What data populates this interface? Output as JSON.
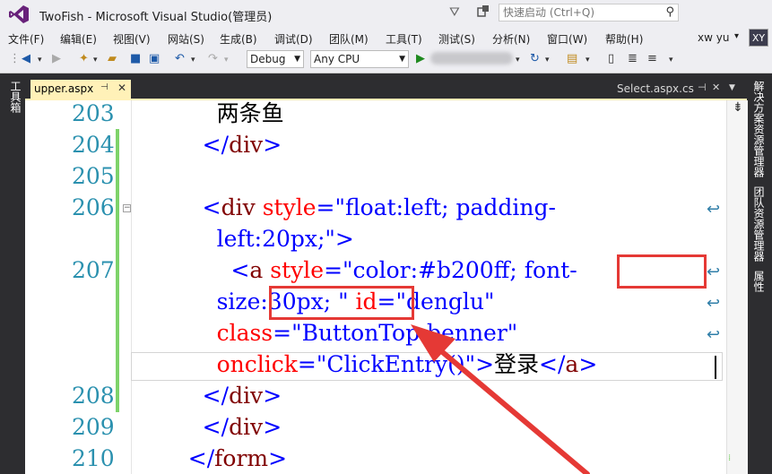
{
  "window": {
    "title": "TwoFish - Microsoft Visual Studio(管理员)",
    "quick_launch_placeholder": "快速启动 (Ctrl+Q)"
  },
  "menu": {
    "items": [
      "文件(F)",
      "编辑(E)",
      "视图(V)",
      "网站(S)",
      "生成(B)",
      "调试(D)",
      "团队(M)",
      "工具(T)",
      "测试(S)",
      "分析(N)",
      "窗口(W)",
      "帮助(H)"
    ],
    "user_name": "xw yu",
    "avatar_initials": "XY"
  },
  "toolbar": {
    "configuration": "Debug",
    "platform": "Any CPU"
  },
  "side_panels": {
    "left": "工具箱",
    "right": [
      "解决方案资源管理器",
      "团队资源管理器",
      "属性"
    ]
  },
  "tabs": {
    "active": "upper.aspx",
    "inactive": "Select.aspx.cs"
  },
  "editor": {
    "line_numbers": [
      "203",
      "204",
      "205",
      "206",
      "207",
      "208",
      "209",
      "210"
    ],
    "lines": {
      "l203": [
        {
          "t": "        两条鱼",
          "c": "black"
        }
      ],
      "l204": [
        {
          "t": "      </",
          "c": "blue"
        },
        {
          "t": "div",
          "c": "maroon"
        },
        {
          "t": ">",
          "c": "blue"
        }
      ],
      "l206a": [
        {
          "t": "      <",
          "c": "blue"
        },
        {
          "t": "div",
          "c": "maroon"
        },
        {
          "t": " style",
          "c": "red"
        },
        {
          "t": "=\"float:left; padding-",
          "c": "blue"
        }
      ],
      "l206b": [
        {
          "t": "        left:20px;\">",
          "c": "blue"
        }
      ],
      "l207a": [
        {
          "t": "          <",
          "c": "blue"
        },
        {
          "t": "a",
          "c": "maroon"
        },
        {
          "t": " style",
          "c": "red"
        },
        {
          "t": "=\"color:#b200ff; font-",
          "c": "blue"
        }
      ],
      "l207b": [
        {
          "t": "        size:30px; \"",
          "c": "blue"
        },
        {
          "t": " id",
          "c": "red"
        },
        {
          "t": "=\"denglu\"",
          "c": "blue"
        }
      ],
      "l207c": [
        {
          "t": "        class",
          "c": "red"
        },
        {
          "t": "=\"ButtonTop benner\"",
          "c": "blue"
        }
      ],
      "l207d": [
        {
          "t": "        onclick",
          "c": "red"
        },
        {
          "t": "=\"ClickEntry()\">",
          "c": "blue"
        },
        {
          "t": "登录",
          "c": "black"
        },
        {
          "t": "</",
          "c": "blue"
        },
        {
          "t": "a",
          "c": "maroon"
        },
        {
          "t": ">",
          "c": "blue"
        }
      ],
      "l208": [
        {
          "t": "      </",
          "c": "blue"
        },
        {
          "t": "div",
          "c": "maroon"
        },
        {
          "t": ">",
          "c": "blue"
        }
      ],
      "l209": [
        {
          "t": "      </",
          "c": "blue"
        },
        {
          "t": "div",
          "c": "maroon"
        },
        {
          "t": ">",
          "c": "blue"
        }
      ],
      "l210": [
        {
          "t": "    </",
          "c": "blue"
        },
        {
          "t": "form",
          "c": "maroon"
        },
        {
          "t": ">",
          "c": "blue"
        }
      ]
    }
  },
  "colors": {
    "code_blue": "#0000ff",
    "code_maroon": "#800000",
    "code_red": "#ff0000",
    "line_number": "#2b91af",
    "change_indicator": "#7ed36a",
    "annotation_red": "#e53935"
  }
}
